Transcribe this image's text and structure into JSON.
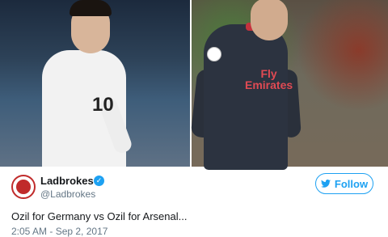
{
  "tweet": {
    "display_name": "Ladbrokes",
    "handle": "@Ladbrokes",
    "follow_label": "Follow",
    "text": "Ozil for Germany vs Ozil for Arsenal...",
    "timestamp": "2:05 AM - Sep 2, 2017",
    "verified_icon": "checkmark-icon",
    "follow_icon": "twitter-bird-icon"
  },
  "photos": {
    "left_shirt_number": "10",
    "right_sponsor": "Fly\nEmirates"
  },
  "colors": {
    "accent": "#1da1f2",
    "brand": "#c02b2b",
    "text": "#14171a",
    "muted": "#657786"
  }
}
